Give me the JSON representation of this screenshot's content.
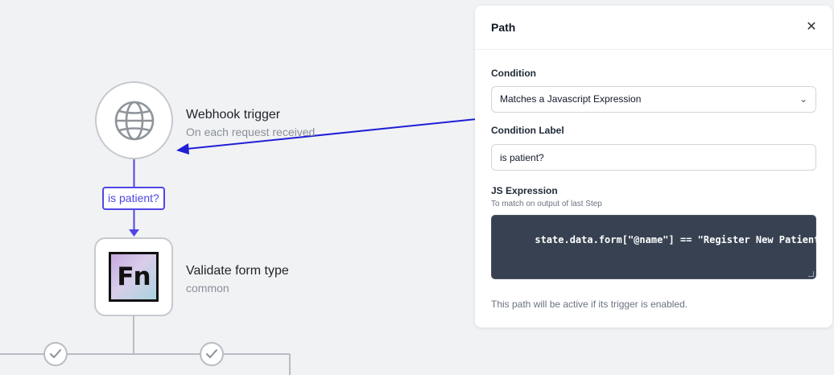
{
  "workflow": {
    "trigger_node": {
      "title": "Webhook trigger",
      "subtitle": "On each request received",
      "icon": "globe-icon"
    },
    "edge": {
      "label": "is patient?",
      "color": "#4f46e5"
    },
    "job_node": {
      "title": "Validate form type",
      "subtitle": "common",
      "icon": "fn-logo"
    },
    "branch_checks": [
      "check-icon",
      "check-icon"
    ]
  },
  "panel": {
    "title": "Path",
    "close_icon": "close-icon",
    "condition": {
      "label": "Condition",
      "selected": "Matches a Javascript Expression"
    },
    "condition_label": {
      "label": "Condition Label",
      "value": "is patient?"
    },
    "js_expression": {
      "label": "JS Expression",
      "help": "To match on output of last Step",
      "value": "state.data.form[\"@name\"] == \"Register New Patient\""
    },
    "footer": "This path will be active if its trigger is enabled."
  },
  "colors": {
    "accent": "#4f46e5",
    "canvas": "#f1f2f4",
    "node_border": "#c6c9cf",
    "code_bg": "#374151"
  }
}
